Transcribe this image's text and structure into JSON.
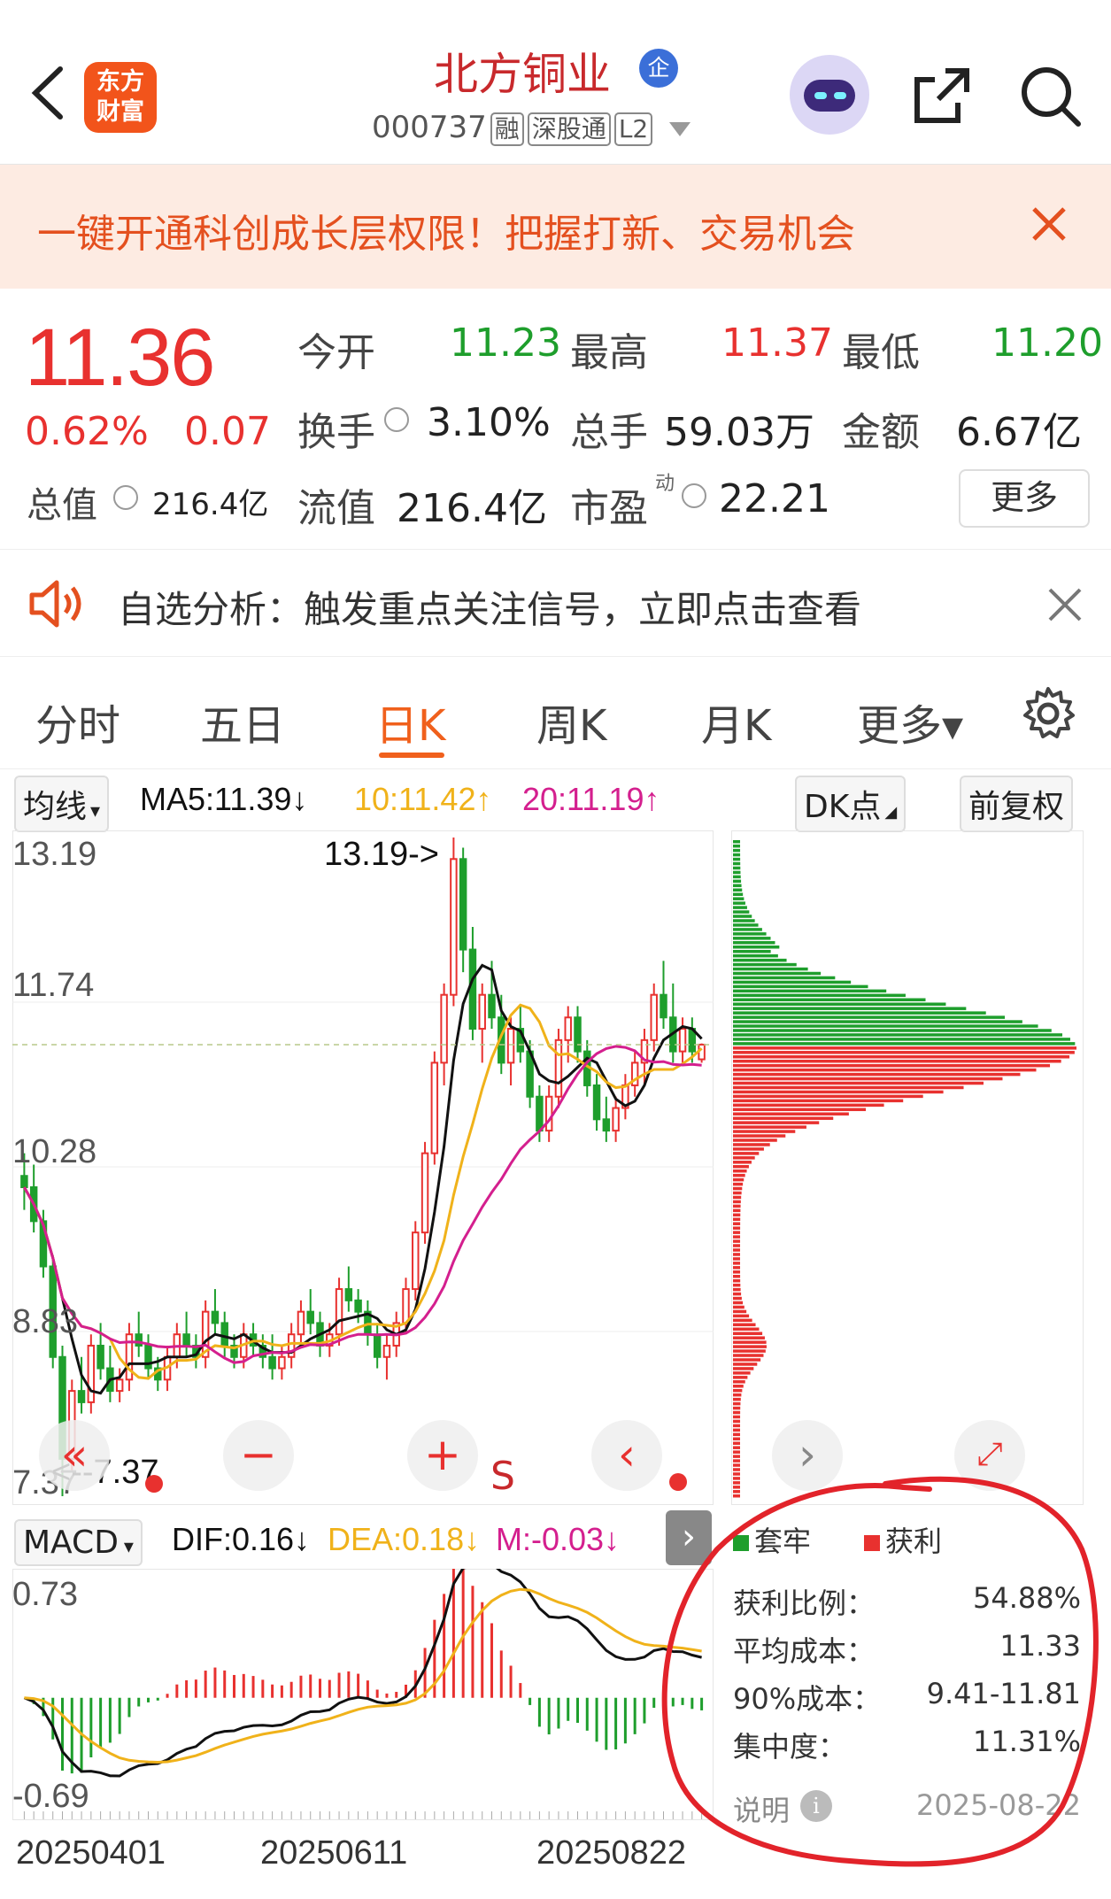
{
  "header": {
    "logo_text": "东方\n财富",
    "stock_name": "北方铜业",
    "badge": "企",
    "code": "000737",
    "tags": [
      "融",
      "深股通",
      "L2"
    ]
  },
  "banner": {
    "text": "一键开通科创成长层权限！把握打新、交易机会",
    "close": "×"
  },
  "quote": {
    "price": "11.36",
    "change_pct": "0.62%",
    "change": "0.07",
    "open_label": "今开",
    "open": "11.23",
    "high_label": "最高",
    "high": "11.37",
    "low_label": "最低",
    "low": "11.20",
    "turnover_label": "换手",
    "turnover": "3.10%",
    "volume_label": "总手",
    "volume": "59.03万",
    "amount_label": "金额",
    "amount": "6.67亿",
    "total_cap_label": "总值",
    "total_cap": "216.4亿",
    "float_cap_label": "流值",
    "float_cap": "216.4亿",
    "pe_label": "市盈",
    "pe_sup": "动",
    "pe": "22.21",
    "more": "更多"
  },
  "analysis": {
    "text": "自选分析：触发重点关注信号，立即点击查看",
    "close": "×"
  },
  "tabs": [
    {
      "label": "分时"
    },
    {
      "label": "五日"
    },
    {
      "label": "日K"
    },
    {
      "label": "周K"
    },
    {
      "label": "月K"
    },
    {
      "label": "更多▾"
    }
  ],
  "ma_bar": {
    "selector": "均线",
    "ma5": "MA5:11.39↓",
    "ma10": "10:11.42↑",
    "ma20": "20:11.19↑",
    "dk": "DK点",
    "fq": "前复权"
  },
  "kline": {
    "y_labels": [
      "13.19",
      "11.74",
      "10.28",
      "8.83",
      "7.37"
    ],
    "max_mark": "13.19->",
    "min_mark": "<--7.37",
    "s_marker": "S"
  },
  "macd_bar": {
    "selector": "MACD",
    "dif": "DIF:0.16↓",
    "dea": "DEA:0.18↓",
    "m": "M:-0.03↓",
    "y_top": "0.73",
    "y_bottom": "-0.69"
  },
  "dates": [
    "20250401",
    "20250611",
    "20250822"
  ],
  "chip": {
    "legend_trapped": "套牢",
    "legend_profit": "获利",
    "stats": [
      {
        "label": "获利比例：",
        "value": "54.88%"
      },
      {
        "label": "平均成本：",
        "value": "11.33"
      },
      {
        "label": "90%成本：",
        "value": "9.41-11.81"
      },
      {
        "label": "集中度：",
        "value": "11.31%"
      }
    ],
    "note": "说明",
    "date": "2025-08-22"
  },
  "colors": {
    "up": "#e8312f",
    "down": "#1e9e2c",
    "ma5": "#111111",
    "ma10": "#f0b21a",
    "ma20": "#d41f8e",
    "accent": "#f0601c"
  },
  "chart_data": {
    "type": "candlestick",
    "ylim": [
      7.37,
      13.19
    ],
    "candles": [
      [
        10.2,
        10.4,
        9.9,
        10.1
      ],
      [
        10.1,
        10.3,
        9.7,
        9.8
      ],
      [
        9.8,
        9.9,
        9.3,
        9.4
      ],
      [
        9.4,
        9.5,
        8.5,
        8.6
      ],
      [
        8.6,
        8.7,
        7.37,
        7.7
      ],
      [
        7.7,
        8.4,
        7.6,
        8.3
      ],
      [
        8.3,
        8.6,
        8.1,
        8.2
      ],
      [
        8.2,
        8.8,
        8.1,
        8.7
      ],
      [
        8.7,
        8.9,
        8.4,
        8.5
      ],
      [
        8.5,
        8.7,
        8.2,
        8.3
      ],
      [
        8.3,
        8.5,
        8.2,
        8.4
      ],
      [
        8.4,
        8.9,
        8.3,
        8.8
      ],
      [
        8.8,
        9.0,
        8.6,
        8.7
      ],
      [
        8.7,
        8.8,
        8.4,
        8.5
      ],
      [
        8.5,
        8.6,
        8.3,
        8.4
      ],
      [
        8.4,
        8.7,
        8.3,
        8.6
      ],
      [
        8.6,
        8.9,
        8.5,
        8.8
      ],
      [
        8.8,
        9.0,
        8.6,
        8.7
      ],
      [
        8.7,
        8.8,
        8.5,
        8.6
      ],
      [
        8.6,
        9.1,
        8.5,
        9.0
      ],
      [
        9.0,
        9.2,
        8.8,
        8.9
      ],
      [
        8.9,
        9.0,
        8.6,
        8.7
      ],
      [
        8.7,
        8.8,
        8.5,
        8.6
      ],
      [
        8.6,
        8.9,
        8.5,
        8.8
      ],
      [
        8.8,
        8.9,
        8.6,
        8.7
      ],
      [
        8.7,
        8.8,
        8.5,
        8.6
      ],
      [
        8.6,
        8.8,
        8.4,
        8.5
      ],
      [
        8.5,
        8.7,
        8.4,
        8.6
      ],
      [
        8.6,
        8.9,
        8.5,
        8.8
      ],
      [
        8.8,
        9.1,
        8.7,
        9.0
      ],
      [
        9.0,
        9.2,
        8.8,
        8.9
      ],
      [
        8.9,
        9.0,
        8.6,
        8.7
      ],
      [
        8.7,
        8.9,
        8.6,
        8.8
      ],
      [
        8.8,
        9.3,
        8.7,
        9.2
      ],
      [
        9.2,
        9.4,
        9.0,
        9.1
      ],
      [
        9.1,
        9.2,
        8.9,
        9.0
      ],
      [
        9.0,
        9.1,
        8.7,
        8.8
      ],
      [
        8.8,
        8.9,
        8.5,
        8.6
      ],
      [
        8.6,
        8.8,
        8.4,
        8.7
      ],
      [
        8.7,
        9.0,
        8.6,
        8.9
      ],
      [
        8.9,
        9.3,
        8.8,
        9.2
      ],
      [
        9.2,
        9.8,
        9.1,
        9.7
      ],
      [
        9.7,
        10.5,
        9.6,
        10.4
      ],
      [
        10.4,
        11.3,
        10.3,
        11.2
      ],
      [
        11.2,
        11.9,
        11.0,
        11.8
      ],
      [
        11.8,
        13.19,
        11.7,
        13.0
      ],
      [
        13.0,
        13.1,
        12.0,
        12.2
      ],
      [
        12.2,
        12.4,
        11.4,
        11.5
      ],
      [
        11.5,
        11.9,
        11.2,
        11.8
      ],
      [
        11.8,
        12.1,
        11.5,
        11.6
      ],
      [
        11.6,
        11.8,
        11.1,
        11.2
      ],
      [
        11.2,
        11.6,
        11.0,
        11.5
      ],
      [
        11.5,
        11.7,
        11.2,
        11.3
      ],
      [
        11.3,
        11.4,
        10.8,
        10.9
      ],
      [
        10.9,
        11.0,
        10.5,
        10.6
      ],
      [
        10.6,
        11.0,
        10.5,
        10.9
      ],
      [
        10.9,
        11.5,
        10.8,
        11.4
      ],
      [
        11.4,
        11.7,
        11.2,
        11.6
      ],
      [
        11.6,
        11.7,
        11.2,
        11.3
      ],
      [
        11.3,
        11.4,
        10.9,
        11.0
      ],
      [
        11.0,
        11.1,
        10.6,
        10.7
      ],
      [
        10.7,
        10.9,
        10.5,
        10.6
      ],
      [
        10.6,
        10.9,
        10.5,
        10.8
      ],
      [
        10.8,
        11.1,
        10.7,
        11.0
      ],
      [
        11.0,
        11.3,
        10.9,
        11.2
      ],
      [
        11.2,
        11.5,
        11.0,
        11.4
      ],
      [
        11.4,
        11.9,
        11.3,
        11.8
      ],
      [
        11.8,
        12.1,
        11.5,
        11.6
      ],
      [
        11.6,
        11.9,
        11.2,
        11.3
      ],
      [
        11.3,
        11.6,
        11.2,
        11.5
      ],
      [
        11.5,
        11.6,
        11.2,
        11.3
      ],
      [
        11.23,
        11.37,
        11.2,
        11.36
      ]
    ],
    "macd": {
      "ylim": [
        -0.69,
        0.73
      ]
    }
  }
}
